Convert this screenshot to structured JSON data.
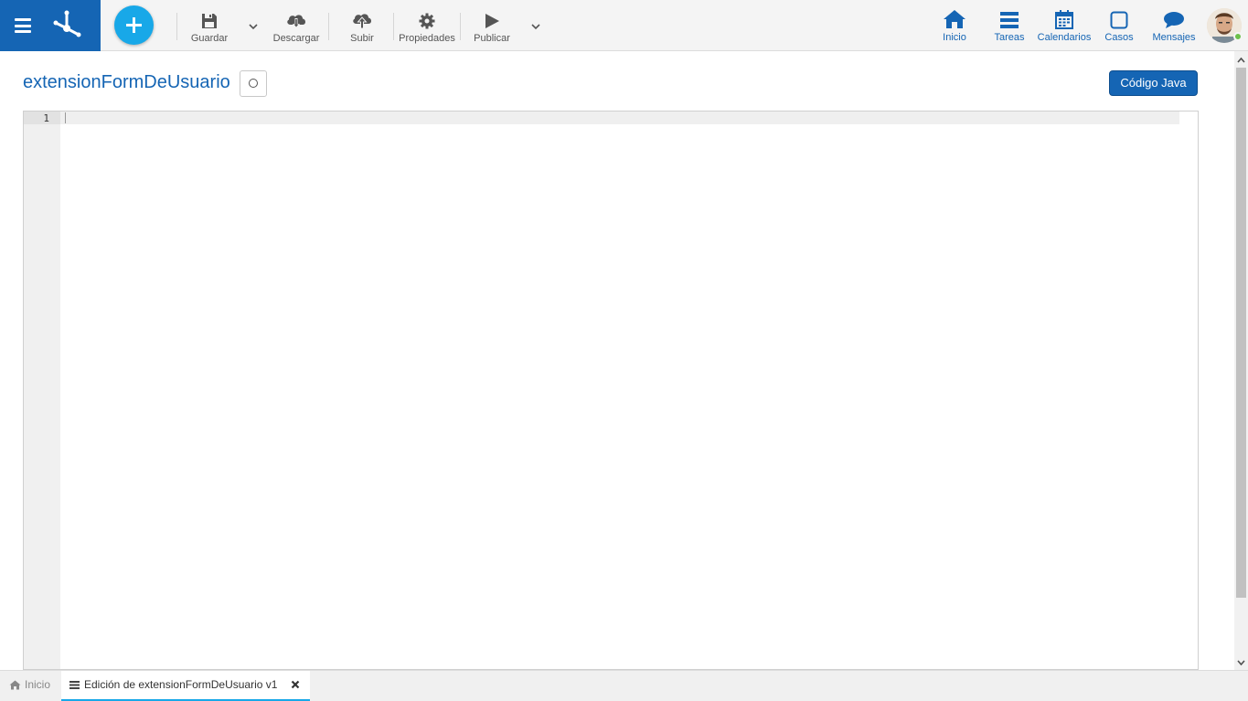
{
  "toolbar": {
    "save_label": "Guardar",
    "download_label": "Descargar",
    "upload_label": "Subir",
    "properties_label": "Propiedades",
    "publish_label": "Publicar"
  },
  "nav": {
    "home_label": "Inicio",
    "tasks_label": "Tareas",
    "calendars_label": "Calendarios",
    "cases_label": "Casos",
    "messages_label": "Mensajes"
  },
  "header": {
    "title": "extensionFormDeUsuario",
    "java_button_label": "Código Java"
  },
  "editor": {
    "line_numbers": [
      "1"
    ],
    "content": ""
  },
  "bottom_tabs": {
    "home_label": "Inicio",
    "active_tab_label": "Edición de extensionFormDeUsuario v1"
  },
  "colors": {
    "brand_blue": "#1565b4",
    "accent_cyan": "#18a8e8",
    "status_online": "#6cc04a"
  },
  "icons": {
    "menu": "hamburger-icon",
    "logo": "app-logo",
    "add": "plus-icon",
    "save": "floppy-icon",
    "download": "cloud-download-icon",
    "upload": "cloud-upload-icon",
    "properties": "gear-icon",
    "publish": "play-icon",
    "home": "home-icon",
    "tasks": "tasks-icon",
    "calendars": "calendar-icon",
    "cases": "square-icon",
    "messages": "chat-bubble-icon",
    "close": "close-icon"
  }
}
